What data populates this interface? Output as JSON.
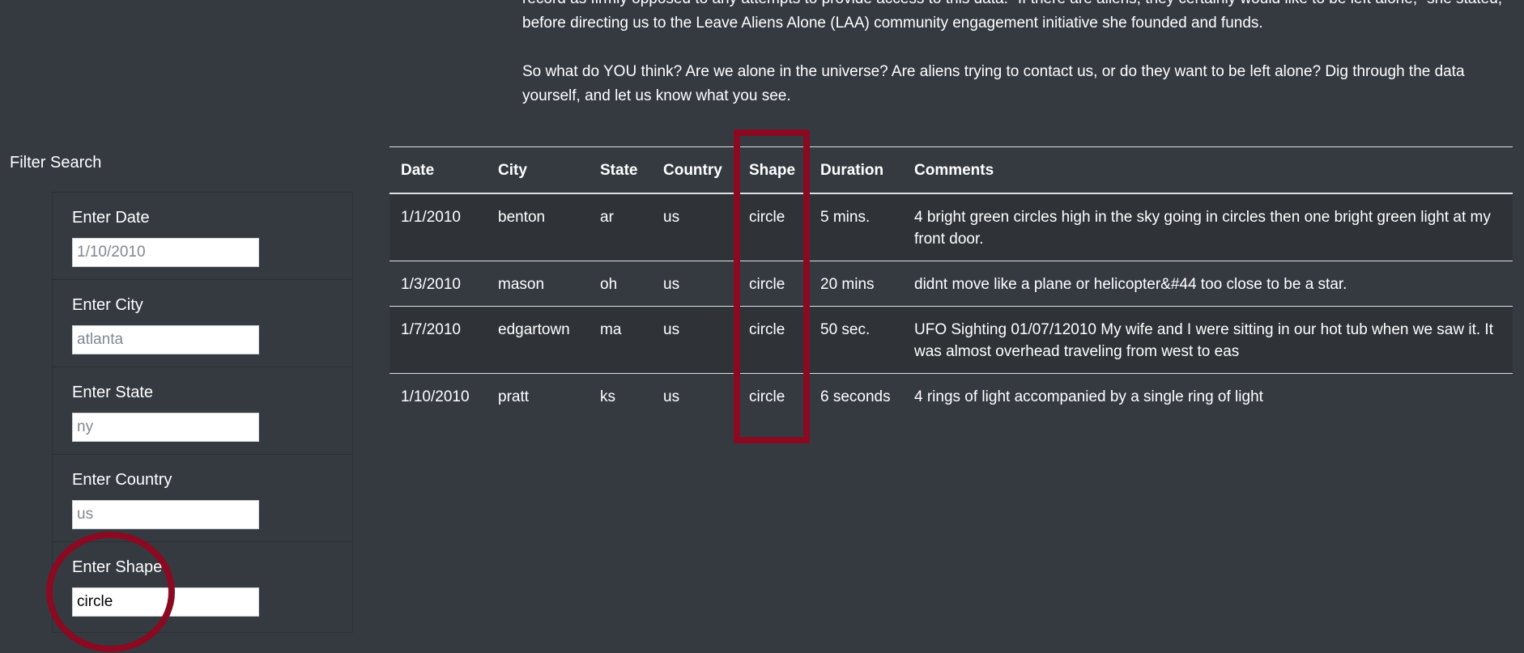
{
  "intro": {
    "paragraph1": "record as firmly opposed to any attempts to provide access to this data. \"If there are aliens, they certainly would like to be left alone,\" she stated, before directing us to the Leave Aliens Alone (LAA) community engagement initiative she founded and funds.",
    "paragraph2": "So what do YOU think? Are we alone in the universe? Are aliens trying to contact us, or do they want to be left alone? Dig through the data yourself, and let us know what you see."
  },
  "filter": {
    "title": "Filter Search",
    "fields": [
      {
        "label": "Enter Date",
        "placeholder": "1/10/2010",
        "value": ""
      },
      {
        "label": "Enter City",
        "placeholder": "atlanta",
        "value": ""
      },
      {
        "label": "Enter State",
        "placeholder": "ny",
        "value": ""
      },
      {
        "label": "Enter Country",
        "placeholder": "us",
        "value": ""
      },
      {
        "label": "Enter Shape",
        "placeholder": "",
        "value": "circle"
      }
    ]
  },
  "table": {
    "headers": [
      "Date",
      "City",
      "State",
      "Country",
      "Shape",
      "Duration",
      "Comments"
    ],
    "rows": [
      [
        "1/1/2010",
        "benton",
        "ar",
        "us",
        "circle",
        "5 mins.",
        "4 bright green circles high in the sky going in circles then one bright green light at my front door."
      ],
      [
        "1/3/2010",
        "mason",
        "oh",
        "us",
        "circle",
        "20 mins",
        "didnt move like a plane or helicopter&#44 too close to be a star."
      ],
      [
        "1/7/2010",
        "edgartown",
        "ma",
        "us",
        "circle",
        "50 sec.",
        "UFO Sighting 01/07/12010 My wife and I were sitting in our hot tub when we saw it. It was almost overhead traveling from west to eas"
      ],
      [
        "1/10/2010",
        "pratt",
        "ks",
        "us",
        "circle",
        "6 seconds",
        "4 rings of light accompanied by a single ring of light"
      ]
    ]
  },
  "colors": {
    "background": "#353a41",
    "stripe": "#2f3338",
    "highlight": "#8a0a22"
  }
}
